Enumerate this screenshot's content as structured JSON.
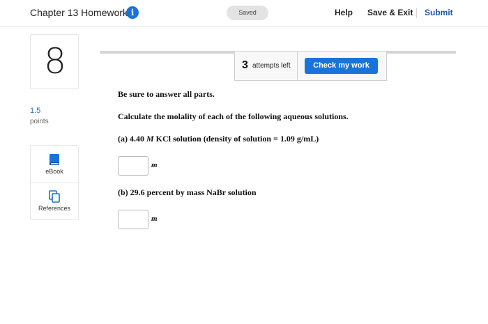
{
  "header": {
    "title": "Chapter 13 Homework",
    "info_icon": "i",
    "saved_label": "Saved",
    "help_label": "Help",
    "save_exit_label": "Save & Exit",
    "submit_label": "Submit"
  },
  "question": {
    "number": "8",
    "points_value": "1.5",
    "points_label": "points"
  },
  "tools": {
    "ebook": {
      "label": "eBook",
      "icon": "book-icon"
    },
    "references": {
      "label": "References",
      "icon": "documents-icon"
    }
  },
  "attempts": {
    "count": "3",
    "label": "attempts left",
    "check_button": "Check my work"
  },
  "body": {
    "instruction": "Be sure to answer all parts.",
    "prompt": "Calculate the molality of each of the following aqueous solutions.",
    "part_a_prefix": "(a) 4.40 ",
    "part_a_unit": "M",
    "part_a_suffix": " KCl solution (density of solution = 1.09 g/mL)",
    "part_a_value": "",
    "part_a_answer_unit": "m",
    "part_b": "(b) 29.6 percent by mass NaBr solution",
    "part_b_value": "",
    "part_b_answer_unit": "m"
  },
  "colors": {
    "accent": "#1a73d9",
    "submit": "#1e56a8"
  }
}
